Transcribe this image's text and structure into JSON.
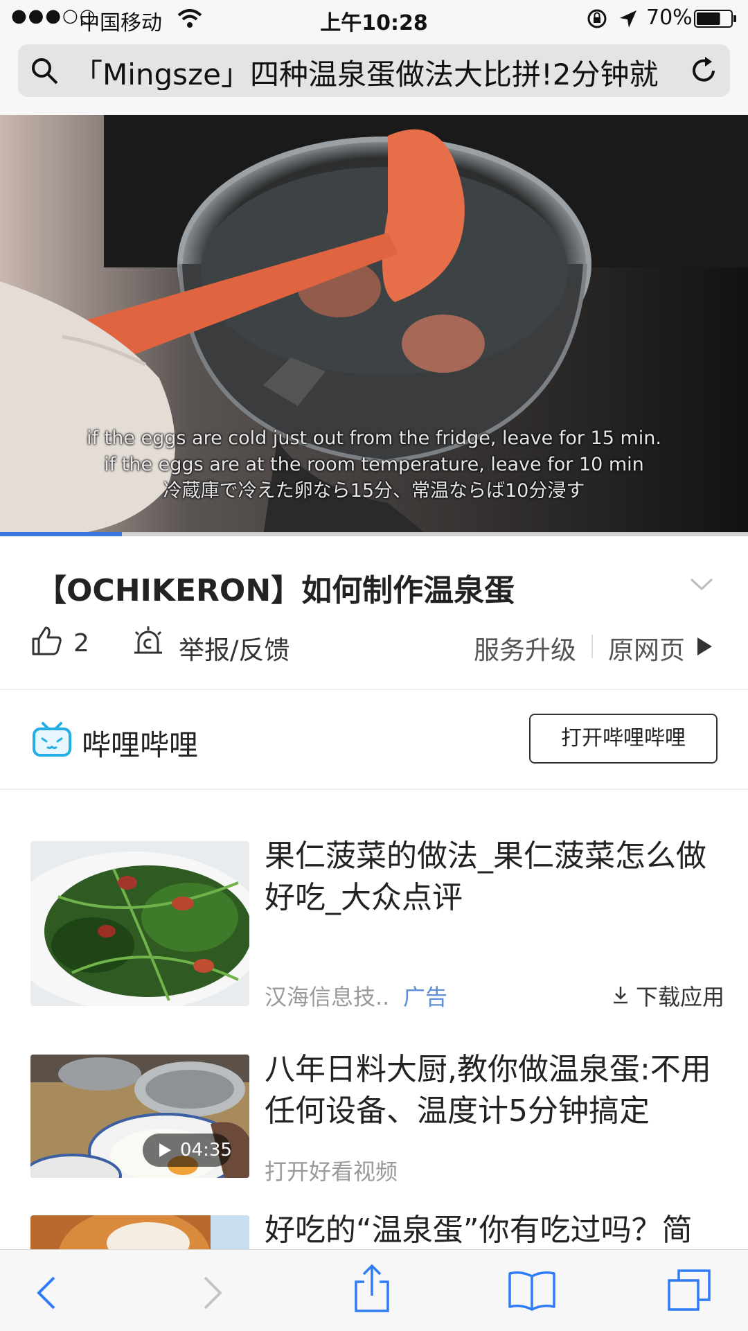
{
  "status_bar": {
    "signal": "●●●○○",
    "carrier": "中国移动",
    "time": "上午10:28",
    "battery_percent": "70%",
    "battery_level": 0.7
  },
  "address_bar": {
    "url_text": "「Mingsze」四种温泉蛋做法大比拼!2分钟就"
  },
  "video": {
    "subtitle_lines": [
      "if the eggs are cold just out from the fridge, leave for 15 min.",
      "if the eggs are at the room temperature, leave for 10 min",
      "冷蔵庫で冷えた卵なら15分、常温ならば10分浸す"
    ],
    "progress": 0.163
  },
  "title": "【OCHIKERON】如何制作温泉蛋",
  "actions": {
    "like_count": "2",
    "report_label": "举报/反馈",
    "service_upgrade": "服务升级",
    "original_page": "原网页"
  },
  "source_row": {
    "name": "哔哩哔哩",
    "open_button": "打开哔哩哔哩"
  },
  "feed": {
    "items": [
      {
        "title": "果仁菠菜的做法_果仁菠菜怎么做好吃_大众点评",
        "source": "汉海信息技..",
        "ad_label": "广告",
        "download_label": "下载应用"
      },
      {
        "title": "八年日料大厨,教你做温泉蛋:不用任何设备、温度计5分钟搞定",
        "duration": "04:35",
        "source": "打开好看视频"
      },
      {
        "title": "好吃的“温泉蛋”你有吃过吗？简单"
      }
    ]
  },
  "colors": {
    "accent": "#3a78e0",
    "ad": "#5b8fd6",
    "bilibili": "#23ade5",
    "toolbar_icon": "#2f7bf6"
  }
}
